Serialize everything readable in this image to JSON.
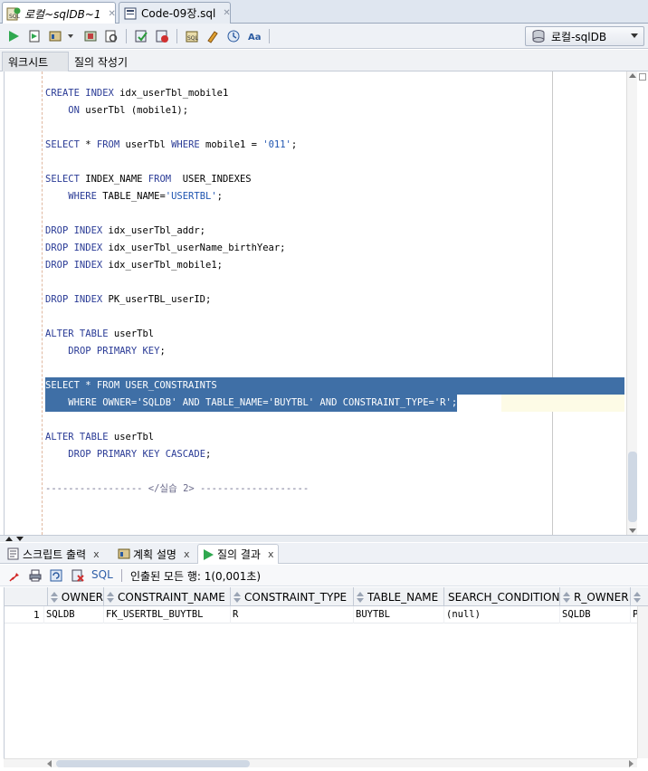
{
  "doc_tabs": [
    {
      "label": "로컬~sqlDB~1",
      "active": true
    },
    {
      "label": "Code-09장.sql",
      "active": false
    }
  ],
  "toolbar": {
    "connection": "로컬-sqlDB",
    "buttons": [
      "run-statement-icon",
      "run-script-icon",
      "explain-plan-icon",
      "autotrace-icon",
      "sql-tuning-icon",
      "commit-icon",
      "rollback-icon",
      "unshared-worksheet-icon",
      "clear-icon",
      "history-icon",
      "format-icon"
    ]
  },
  "subtabs": [
    "워크시트",
    "질의 작성기"
  ],
  "editor": {
    "lines": [
      [
        {
          "t": "CREATE INDEX",
          "c": "kw"
        },
        {
          "t": " idx_userTbl_mobile1"
        }
      ],
      [
        {
          "t": "    "
        },
        {
          "t": "ON",
          "c": "kw"
        },
        {
          "t": " userTbl (mobile1);"
        }
      ],
      [],
      [
        {
          "t": "SELECT",
          "c": "kw"
        },
        {
          "t": " * "
        },
        {
          "t": "FROM",
          "c": "kw"
        },
        {
          "t": " userTbl "
        },
        {
          "t": "WHERE",
          "c": "kw"
        },
        {
          "t": " mobile1 = "
        },
        {
          "t": "'011'",
          "c": "str"
        },
        {
          "t": ";"
        }
      ],
      [],
      [
        {
          "t": "SELECT",
          "c": "kw"
        },
        {
          "t": " INDEX_NAME "
        },
        {
          "t": "FROM",
          "c": "kw"
        },
        {
          "t": "  USER_INDEXES"
        }
      ],
      [
        {
          "t": "    "
        },
        {
          "t": "WHERE",
          "c": "kw"
        },
        {
          "t": " TABLE_NAME="
        },
        {
          "t": "'USERTBL'",
          "c": "str"
        },
        {
          "t": ";"
        }
      ],
      [],
      [
        {
          "t": "DROP INDEX",
          "c": "kw"
        },
        {
          "t": " idx_userTbl_addr;"
        }
      ],
      [
        {
          "t": "DROP INDEX",
          "c": "kw"
        },
        {
          "t": " idx_userTbl_userName_birthYear;"
        }
      ],
      [
        {
          "t": "DROP INDEX",
          "c": "kw"
        },
        {
          "t": " idx_userTbl_mobile1;"
        }
      ],
      [],
      [
        {
          "t": "DROP INDEX",
          "c": "kw"
        },
        {
          "t": " PK_userTBL_userID;"
        }
      ],
      [],
      [
        {
          "t": "ALTER TABLE",
          "c": "kw"
        },
        {
          "t": " userTbl"
        }
      ],
      [
        {
          "t": "    "
        },
        {
          "t": "DROP PRIMARY KEY",
          "c": "kw"
        },
        {
          "t": ";"
        }
      ],
      [],
      [
        {
          "t": "SELECT * FROM USER_CONSTRAINTS"
        }
      ],
      [
        {
          "t": "    WHERE OWNER='SQLDB' AND TABLE_NAME='BUYTBL' AND CONSTRAINT_TYPE='R';"
        }
      ],
      [],
      [
        {
          "t": "ALTER TABLE",
          "c": "kw"
        },
        {
          "t": " userTbl"
        }
      ],
      [
        {
          "t": "    "
        },
        {
          "t": "DROP PRIMARY KEY CASCADE",
          "c": "kw"
        },
        {
          "t": ";"
        }
      ],
      [],
      [
        {
          "t": "----------------- </실습 2> -------------------",
          "c": "cmt"
        }
      ]
    ],
    "highlighted": [
      17,
      18
    ]
  },
  "result_tabs": [
    {
      "label": "스크립트 출력",
      "active": false
    },
    {
      "label": "계획 설명",
      "active": false
    },
    {
      "label": "질의 결과",
      "active": true
    }
  ],
  "result_toolbar": {
    "sql_label": "SQL",
    "status": "인출된 모든 행: 1(0,001초)"
  },
  "grid": {
    "columns": [
      "OWNER",
      "CONSTRAINT_NAME",
      "CONSTRAINT_TYPE",
      "TABLE_NAME",
      "SEARCH_CONDITION",
      "R_OWNER"
    ],
    "rows": [
      {
        "num": "1",
        "cells": [
          "SQLDB",
          "FK_USERTBL_BUYTBL",
          "R",
          "BUYTBL",
          "(null)",
          "SQLDB",
          "P"
        ]
      }
    ]
  }
}
